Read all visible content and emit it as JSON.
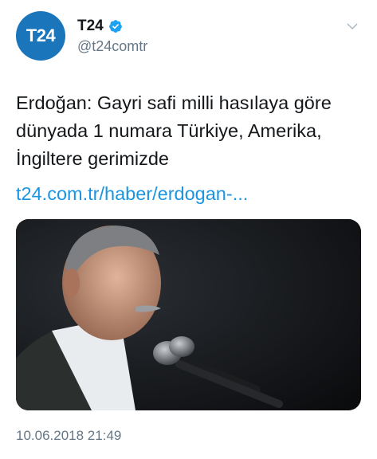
{
  "account": {
    "avatar_text": "T24",
    "display_name": "T24",
    "handle": "@t24comtr",
    "verified": true,
    "avatar_color": "#1b75bb"
  },
  "tweet": {
    "text": "Erdoğan: Gayri safi milli hasılaya göre dünyada 1 numara Türkiye, Amerika, İngiltere gerimizde",
    "link": "t24.com.tr/haber/erdogan-...",
    "timestamp": "10.06.2018 21:49"
  },
  "icons": {
    "verified": "verified-badge-icon",
    "menu": "chevron-down-icon"
  },
  "colors": {
    "link": "#1b95e0",
    "muted": "#657786",
    "verified": "#1da1f2"
  }
}
